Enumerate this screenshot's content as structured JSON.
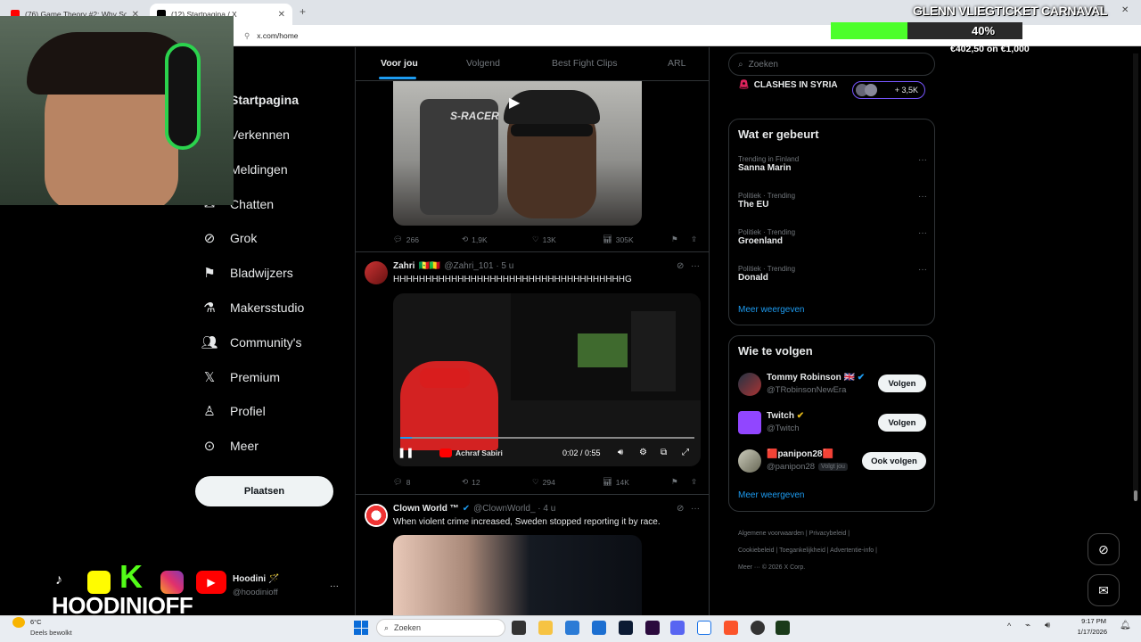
{
  "browser": {
    "tabs": [
      {
        "label": "(76) Game Theory #2: Why Schools F"
      },
      {
        "label": "(12) Startpagina / X"
      }
    ],
    "url": "x.com/home"
  },
  "sidebar": {
    "items": [
      {
        "label": "Startpagina"
      },
      {
        "label": "Verkennen"
      },
      {
        "label": "Meldingen"
      },
      {
        "label": "Chatten"
      },
      {
        "label": "Grok"
      },
      {
        "label": "Bladwijzers"
      },
      {
        "label": "Makersstudio"
      },
      {
        "label": "Community's"
      },
      {
        "label": "Premium"
      },
      {
        "label": "Profiel"
      },
      {
        "label": "Meer"
      }
    ],
    "post_label": "Plaatsen",
    "account": {
      "name": "Hoodini 🪄",
      "handle": "@hoodinioff",
      "more": "···"
    }
  },
  "feed": {
    "tabs": [
      "Voor jou",
      "Volgend",
      "Best Fight Clips",
      "ARL"
    ],
    "posts": [
      {
        "replies": "266",
        "reposts": "1,9K",
        "likes": "13K",
        "views": "305K"
      },
      {
        "author": "Zahri",
        "author_flags": "🇸🇳🇲🇱",
        "handle": "@Zahri_101 · 5 u",
        "text": "HHHHHHHHHHHHHHHHHHHHHHHHHHHHHHHHHHHHG",
        "video": {
          "time": "0:02 / 0:55",
          "progress": 0.04,
          "overlay": "Achraf Sabiri"
        },
        "replies": "8",
        "reposts": "12",
        "likes": "294",
        "views": "14K"
      },
      {
        "author": "Clown World ™",
        "handle": "@ClownWorld_ · 4 u",
        "text": "When violent crime increased, Sweden stopped reporting it by race."
      }
    ]
  },
  "right": {
    "search_placeholder": "Zoeken",
    "live": {
      "label": "CLASHES IN SYRIA",
      "count": "+ 3,5K"
    },
    "trends_title": "Wat er gebeurt",
    "trends": [
      {
        "meta": "Trending in Finland",
        "name": "Sanna Marin"
      },
      {
        "meta": "Politiek · Trending",
        "name": "The EU"
      },
      {
        "meta": "Politiek · Trending",
        "name": "Groenland"
      },
      {
        "meta": "Politiek · Trending",
        "name": "Donald"
      }
    ],
    "show_more": "Meer weergeven",
    "who_title": "Wie te volgen",
    "who": [
      {
        "name": "Tommy Robinson 🇬🇧",
        "handle": "@TRobinsonNewEra",
        "button": "Volgen"
      },
      {
        "name": "Twitch",
        "handle": "@Twitch",
        "button": "Volgen"
      },
      {
        "name": "🟥panipon28🟥",
        "handle": "@panipon28",
        "badge": "Volgt jou",
        "button": "Ook volgen"
      }
    ],
    "footer": [
      "Algemene voorwaarden",
      "Privacybeleid",
      "Cookiebeleid",
      "Toegankelijkheid",
      "Advertentie-info",
      "Meer ···",
      "© 2026 X Corp."
    ]
  },
  "overlay": {
    "title": "GLENN VLIEGTICKET CARNAVAL",
    "progress_label": "40%",
    "progress": 0.4,
    "amount": "€402,50 on €1,000",
    "streamer": "HOODINIOFF"
  },
  "taskbar": {
    "weather_temp": "6°C",
    "weather_desc": "Deels bewolkt",
    "search_placeholder": "Zoeken",
    "time": "9:17 PM",
    "date": "1/17/2026"
  },
  "colors": {
    "accent": "#1d9bf0",
    "verified_gold": "#e2b719",
    "progress_green": "#4cff2a"
  }
}
